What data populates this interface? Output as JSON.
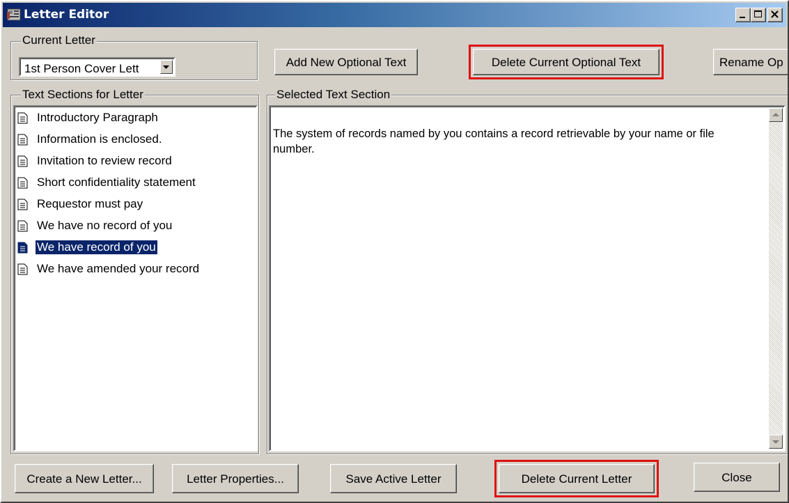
{
  "window": {
    "title": "Letter Editor",
    "icons": {
      "app": "letter-editor-icon",
      "minimize": "minimize-icon",
      "maximize": "maximize-icon",
      "close": "close-icon"
    }
  },
  "current_letter": {
    "group_label": "Current Letter",
    "selected_value": "1st Person Cover Lett"
  },
  "toolbar": {
    "add_optional_text": "Add New Optional Text",
    "delete_optional_text": "Delete Current Optional Text",
    "rename_optional_text": "Rename Op"
  },
  "text_sections": {
    "group_label": "Text Sections for Letter",
    "items": [
      {
        "label": "Introductory Paragraph"
      },
      {
        "label": "Information is enclosed."
      },
      {
        "label": "Invitation to review record"
      },
      {
        "label": "Short confidentiality statement"
      },
      {
        "label": "Requestor must pay"
      },
      {
        "label": "We have no record of you"
      },
      {
        "label": "We have record of you"
      },
      {
        "label": "We have amended your record"
      }
    ],
    "selected_label": "We have record of you"
  },
  "selected_text_section": {
    "group_label": "Selected Text Section",
    "content": "The system of records named by you contains a record retrievable by your name or file number."
  },
  "footer": {
    "create_letter": "Create a New Letter...",
    "letter_properties": "Letter Properties...",
    "save_letter": "Save Active Letter",
    "delete_letter": "Delete Current Letter",
    "close": "Close"
  },
  "colors": {
    "titlebar_start": "#0a246a",
    "titlebar_end": "#a6caf0",
    "window_face": "#d4d0c8",
    "selection": "#0a246a",
    "highlight_outline": "#e01010"
  }
}
